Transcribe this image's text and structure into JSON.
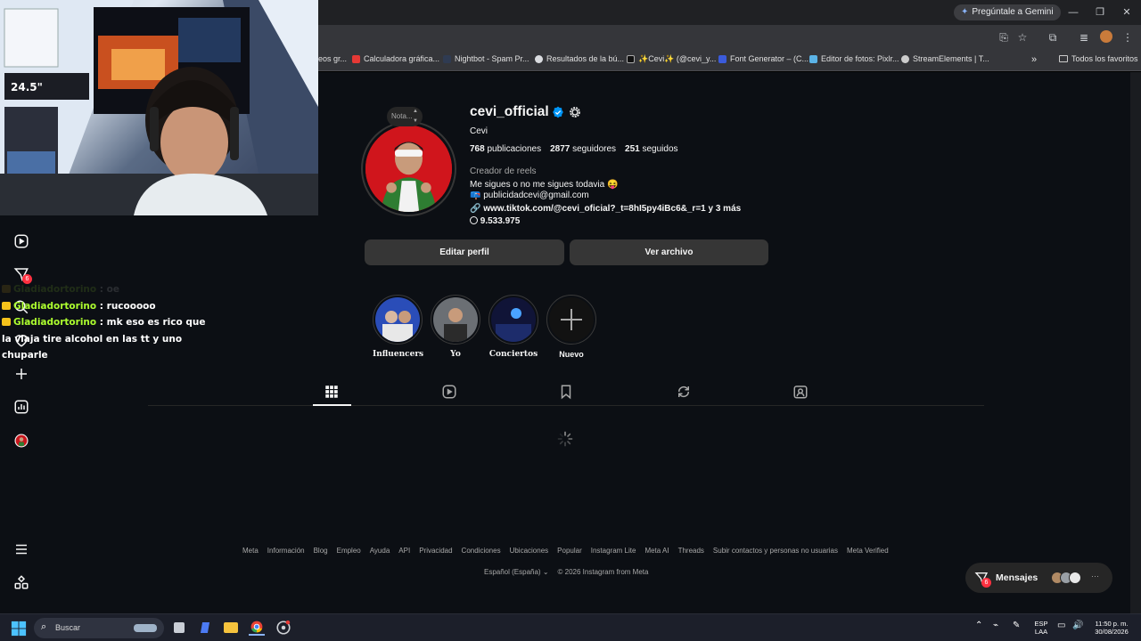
{
  "browser": {
    "gemini_label": "Pregúntale a Gemini",
    "bookmarks": [
      {
        "label": "eos gr...",
        "color": "#5f6368"
      },
      {
        "label": "Calculadora gráfica...",
        "color": "#e53935"
      },
      {
        "label": "Nightbot - Spam Pr...",
        "color": "#2f3b52"
      },
      {
        "label": "Resultados de la bú...",
        "color": "#dadce0"
      },
      {
        "label": "✨Cevi✨ (@cevi_y...",
        "color": "#111111"
      },
      {
        "label": "Font Generator – (C...",
        "color": "#3b5bdb"
      },
      {
        "label": "Editor de fotos: Pixlr...",
        "color": "#5bb3e6"
      },
      {
        "label": "StreamElements | T...",
        "color": "#cccccc"
      }
    ],
    "all_favorites_label": "Todos los favoritos"
  },
  "chat": {
    "messages": [
      {
        "user": "Gladiadortorino",
        "sep": " : ",
        "text": "oe",
        "faded": true
      },
      {
        "user": "Gladiadortorino",
        "sep": " : ",
        "text": "rucooooo",
        "faded": false
      },
      {
        "user": "Gladiadortorino",
        "sep": " : ",
        "text": "mk eso es rico que la viaja tire alcohol en las tt y uno chuparle",
        "faded": false
      }
    ]
  },
  "sidebar": {
    "notifications_count": "6"
  },
  "profile": {
    "note_label": "Nota...",
    "username": "cevi_official",
    "full_name": "Cevi",
    "posts_count": "768",
    "posts_label": "publicaciones",
    "followers_count": "2877",
    "followers_label": "seguidores",
    "following_count": "251",
    "following_label": "seguidos",
    "category": "Creador de reels",
    "bio_line1": "Me sigues o no me sigues todavia 😝",
    "bio_line2": "📪 publicidadcevi@gmail.com",
    "bio_link": "www.tiktok.com/@cevi_oficial?_t=8hI5py4iBc6&_r=1 y 3 más",
    "threads_count": "9.533.975",
    "edit_profile_label": "Editar perfil",
    "archive_label": "Ver archivo",
    "highlights": [
      {
        "label": "Influencers"
      },
      {
        "label": "Yo"
      },
      {
        "label": "Conciertos"
      },
      {
        "label": "Nuevo"
      }
    ]
  },
  "footer": {
    "links": [
      "Meta",
      "Información",
      "Blog",
      "Empleo",
      "Ayuda",
      "API",
      "Privacidad",
      "Condiciones",
      "Ubicaciones",
      "Popular",
      "Instagram Lite",
      "Meta AI",
      "Threads",
      "Subir contactos y personas no usuarias",
      "Meta Verified"
    ],
    "language": "Español (España)",
    "copyright": "© 2026 Instagram from Meta"
  },
  "messages_pill": {
    "label": "Mensajes",
    "badge": "6"
  },
  "taskbar": {
    "search_placeholder": "Buscar",
    "lang_top": "ESP",
    "lang_bottom": "LAA",
    "time": "11:50 p. m.",
    "date": "30/08/2026"
  },
  "colors": {
    "page_bg": "#0c0f14",
    "button_bg": "#363636",
    "verified_blue": "#0095f6",
    "chat_user": "#adff2f",
    "badge_red": "#ff3040"
  }
}
